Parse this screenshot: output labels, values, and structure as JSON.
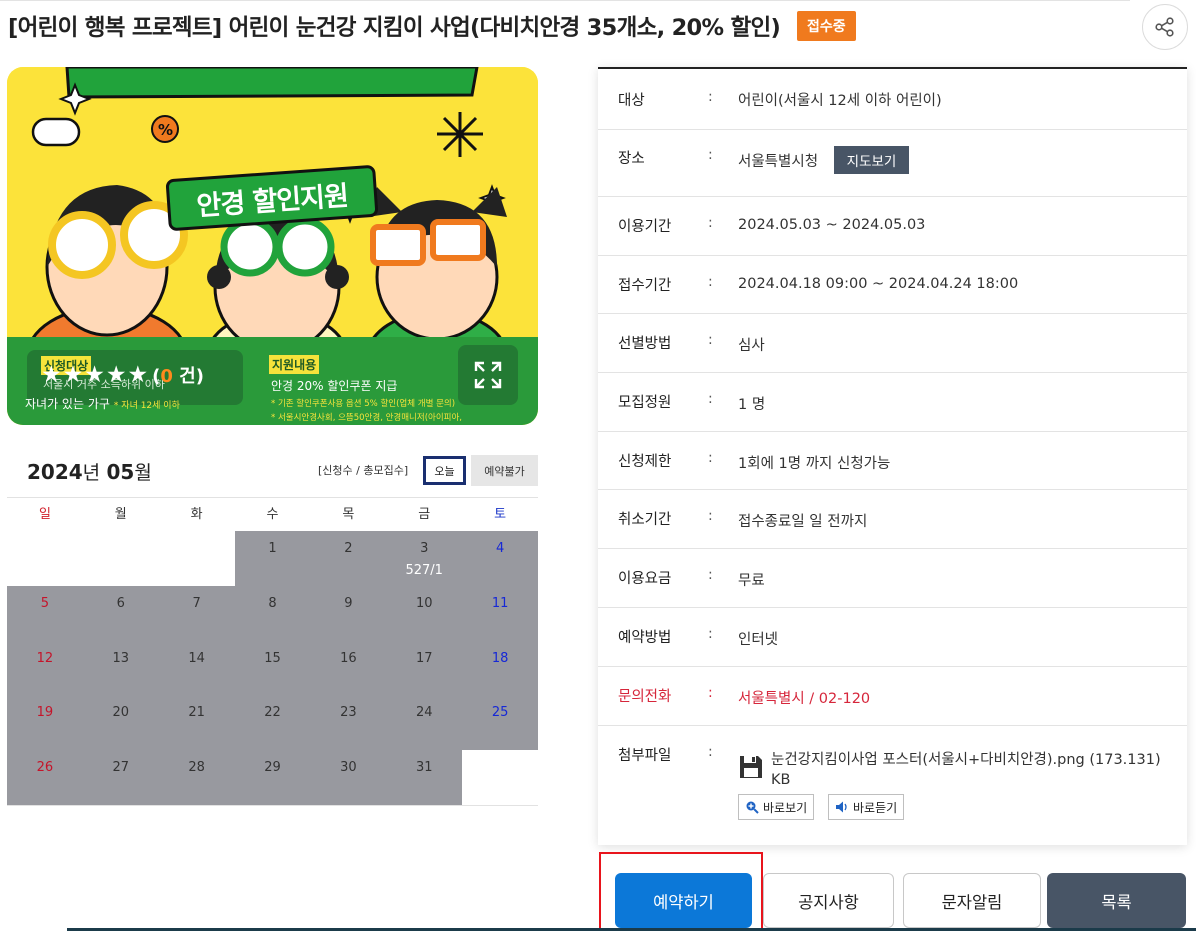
{
  "header": {
    "title": "[어린이 행복 프로젝트] 어린이 눈건강 지킴이 사업(다비치안경 35개소, 20% 할인)",
    "status_badge": "접수중"
  },
  "poster": {
    "banner_text": "안경 할인지원",
    "apply_target_label": "신청대상",
    "apply_target_text": "서울시 거주 소득하위 이하",
    "apply_target_text2": "자녀가 있는 가구",
    "apply_target_note": "* 자녀 12세 이하",
    "rating_count": "0",
    "rating_unit": "건",
    "support_label": "지원내용",
    "support_text": "안경 20% 할인쿠폰 지급",
    "support_note1": "* 기존 할인쿠폰사용 옵션 5% 할인(업체 개별 문의)",
    "support_note2": "* 서울시안경사회, 으뜸50안경, 안경매니저(아이피아,"
  },
  "calendar": {
    "year": "2024",
    "year_unit": "년",
    "month": "05",
    "month_unit": "월",
    "legend": "[신청수 / 총모집수]",
    "today_label": "오늘",
    "unavailable_label": "예약불가",
    "weekdays": [
      "일",
      "월",
      "화",
      "수",
      "목",
      "금",
      "토"
    ],
    "weeks": [
      [
        {
          "d": "",
          "f": false
        },
        {
          "d": "",
          "f": false
        },
        {
          "d": "",
          "f": false
        },
        {
          "d": "1",
          "f": true
        },
        {
          "d": "2",
          "f": true
        },
        {
          "d": "3",
          "f": true,
          "c": "527/1"
        },
        {
          "d": "4",
          "f": true
        }
      ],
      [
        {
          "d": "5",
          "f": true
        },
        {
          "d": "6",
          "f": true
        },
        {
          "d": "7",
          "f": true
        },
        {
          "d": "8",
          "f": true
        },
        {
          "d": "9",
          "f": true
        },
        {
          "d": "10",
          "f": true
        },
        {
          "d": "11",
          "f": true
        }
      ],
      [
        {
          "d": "12",
          "f": true
        },
        {
          "d": "13",
          "f": true
        },
        {
          "d": "14",
          "f": true
        },
        {
          "d": "15",
          "f": true
        },
        {
          "d": "16",
          "f": true
        },
        {
          "d": "17",
          "f": true
        },
        {
          "d": "18",
          "f": true
        }
      ],
      [
        {
          "d": "19",
          "f": true
        },
        {
          "d": "20",
          "f": true
        },
        {
          "d": "21",
          "f": true
        },
        {
          "d": "22",
          "f": true
        },
        {
          "d": "23",
          "f": true
        },
        {
          "d": "24",
          "f": true
        },
        {
          "d": "25",
          "f": true
        }
      ],
      [
        {
          "d": "26",
          "f": true
        },
        {
          "d": "27",
          "f": true
        },
        {
          "d": "28",
          "f": true
        },
        {
          "d": "29",
          "f": true
        },
        {
          "d": "30",
          "f": true
        },
        {
          "d": "31",
          "f": true
        },
        {
          "d": "",
          "f": false
        }
      ]
    ]
  },
  "info": {
    "target": {
      "label": "대상",
      "value": "어린이(서울시 12세 이하 어린이)"
    },
    "place": {
      "label": "장소",
      "value": "서울특별시청",
      "map_button": "지도보기"
    },
    "use_period": {
      "label": "이용기간",
      "value": "2024.05.03 ~ 2024.05.03"
    },
    "apply_period": {
      "label": "접수기간",
      "value": "2024.04.18 09:00 ~ 2024.04.24 18:00"
    },
    "selection": {
      "label": "선별방법",
      "value": "심사"
    },
    "capacity": {
      "label": "모집정원",
      "value": "1 명"
    },
    "limit": {
      "label": "신청제한",
      "value": "1회에 1명 까지 신청가능"
    },
    "cancel": {
      "label": "취소기간",
      "value": "접수종료일 일 전까지"
    },
    "fee": {
      "label": "이용요금",
      "value": "무료"
    },
    "method": {
      "label": "예약방법",
      "value": "인터넷"
    },
    "contact": {
      "label": "문의전화",
      "value": "서울특별시 / 02-120"
    },
    "attachment": {
      "label": "첨부파일",
      "file_name": "눈건강지킴이사업 포스터(서울시+다비치안경).png (173.131) KB",
      "view_button": "바로보기",
      "listen_button": "바로듣기"
    },
    "colon": ":"
  },
  "actions": {
    "reserve": "예약하기",
    "notice": "공지사항",
    "sms": "문자알림",
    "list": "목록"
  },
  "colors": {
    "accent_blue": "#0c78d8",
    "badge_orange": "#f07a1e",
    "slate": "#485566",
    "contact_red": "#d6263b",
    "highlight_red": "#e8141c"
  }
}
